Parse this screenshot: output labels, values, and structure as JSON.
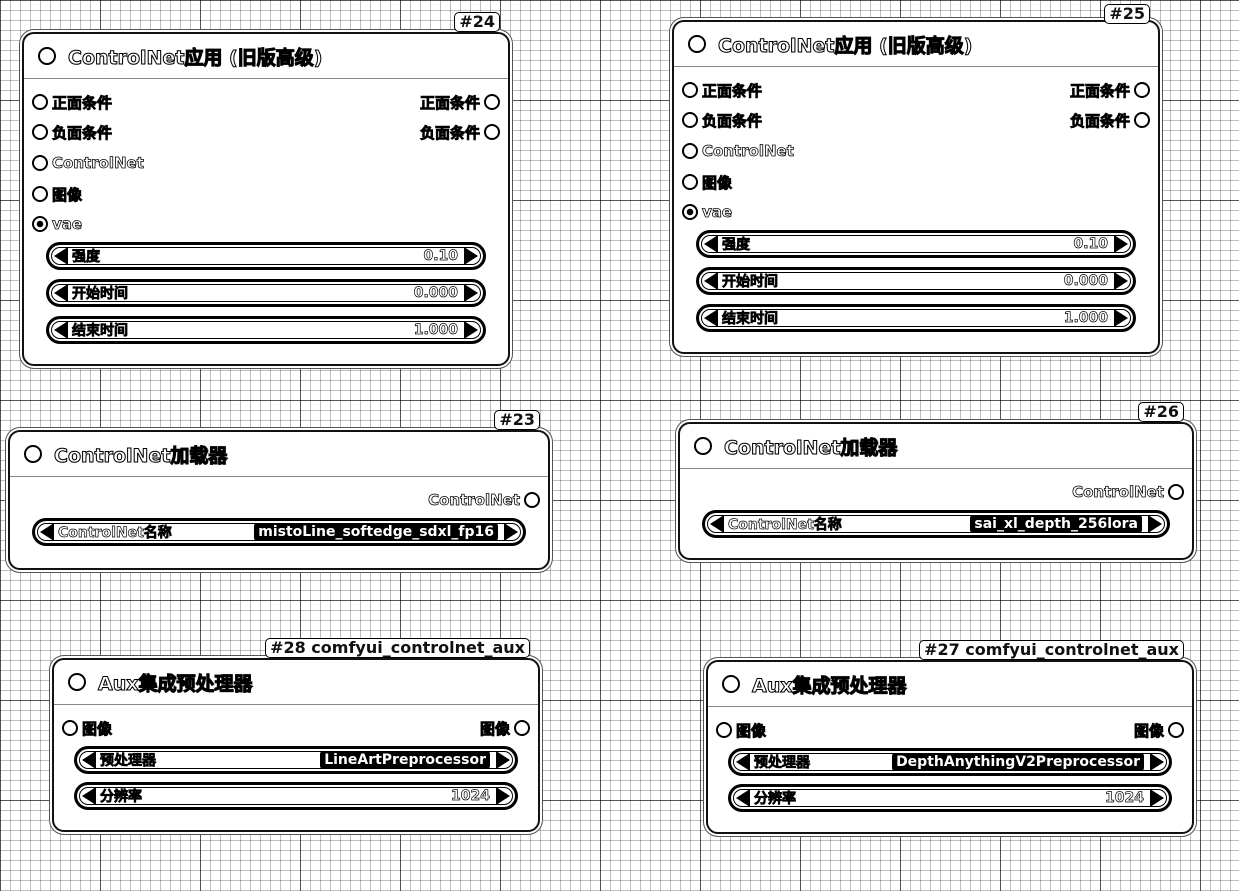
{
  "nodes": {
    "n24": {
      "tag": "#24",
      "title": "ControlNet应用 (旧版高级)",
      "inputs": [
        "正面条件",
        "负面条件",
        "ControlNet",
        "图像",
        "vae"
      ],
      "outputs": [
        "正面条件",
        "负面条件"
      ],
      "widgets": [
        {
          "name": "强度",
          "value": "0.10"
        },
        {
          "name": "开始时间",
          "value": "0.000"
        },
        {
          "name": "结束时间",
          "value": "1.000"
        }
      ]
    },
    "n25": {
      "tag": "#25",
      "title": "ControlNet应用 (旧版高级)",
      "inputs": [
        "正面条件",
        "负面条件",
        "ControlNet",
        "图像",
        "vae"
      ],
      "outputs": [
        "正面条件",
        "负面条件"
      ],
      "widgets": [
        {
          "name": "强度",
          "value": "0.10"
        },
        {
          "name": "开始时间",
          "value": "0.000"
        },
        {
          "name": "结束时间",
          "value": "1.000"
        }
      ]
    },
    "n23": {
      "tag": "#23",
      "title": "ControlNet加载器",
      "outputs": [
        "ControlNet"
      ],
      "widgets": [
        {
          "name": "ControlNet名称",
          "value": "mistoLine_softedge_sdxl_fp16"
        }
      ]
    },
    "n26": {
      "tag": "#26",
      "title": "ControlNet加载器",
      "outputs": [
        "ControlNet"
      ],
      "widgets": [
        {
          "name": "ControlNet名称",
          "value": "sai_xl_depth_256lora"
        }
      ]
    },
    "n28": {
      "tag": "#28 comfyui_controlnet_aux",
      "title": "Aux集成预处理器",
      "inputs": [
        "图像"
      ],
      "outputs": [
        "图像"
      ],
      "widgets": [
        {
          "name": "预处理器",
          "value": "LineArtPreprocessor"
        },
        {
          "name": "分辨率",
          "value": "1024"
        }
      ]
    },
    "n27": {
      "tag": "#27 comfyui_controlnet_aux",
      "title": "Aux集成预处理器",
      "inputs": [
        "图像"
      ],
      "outputs": [
        "图像"
      ],
      "widgets": [
        {
          "name": "预处理器",
          "value": "DepthAnythingV2Preprocessor"
        },
        {
          "name": "分辨率",
          "value": "1024"
        }
      ]
    }
  }
}
